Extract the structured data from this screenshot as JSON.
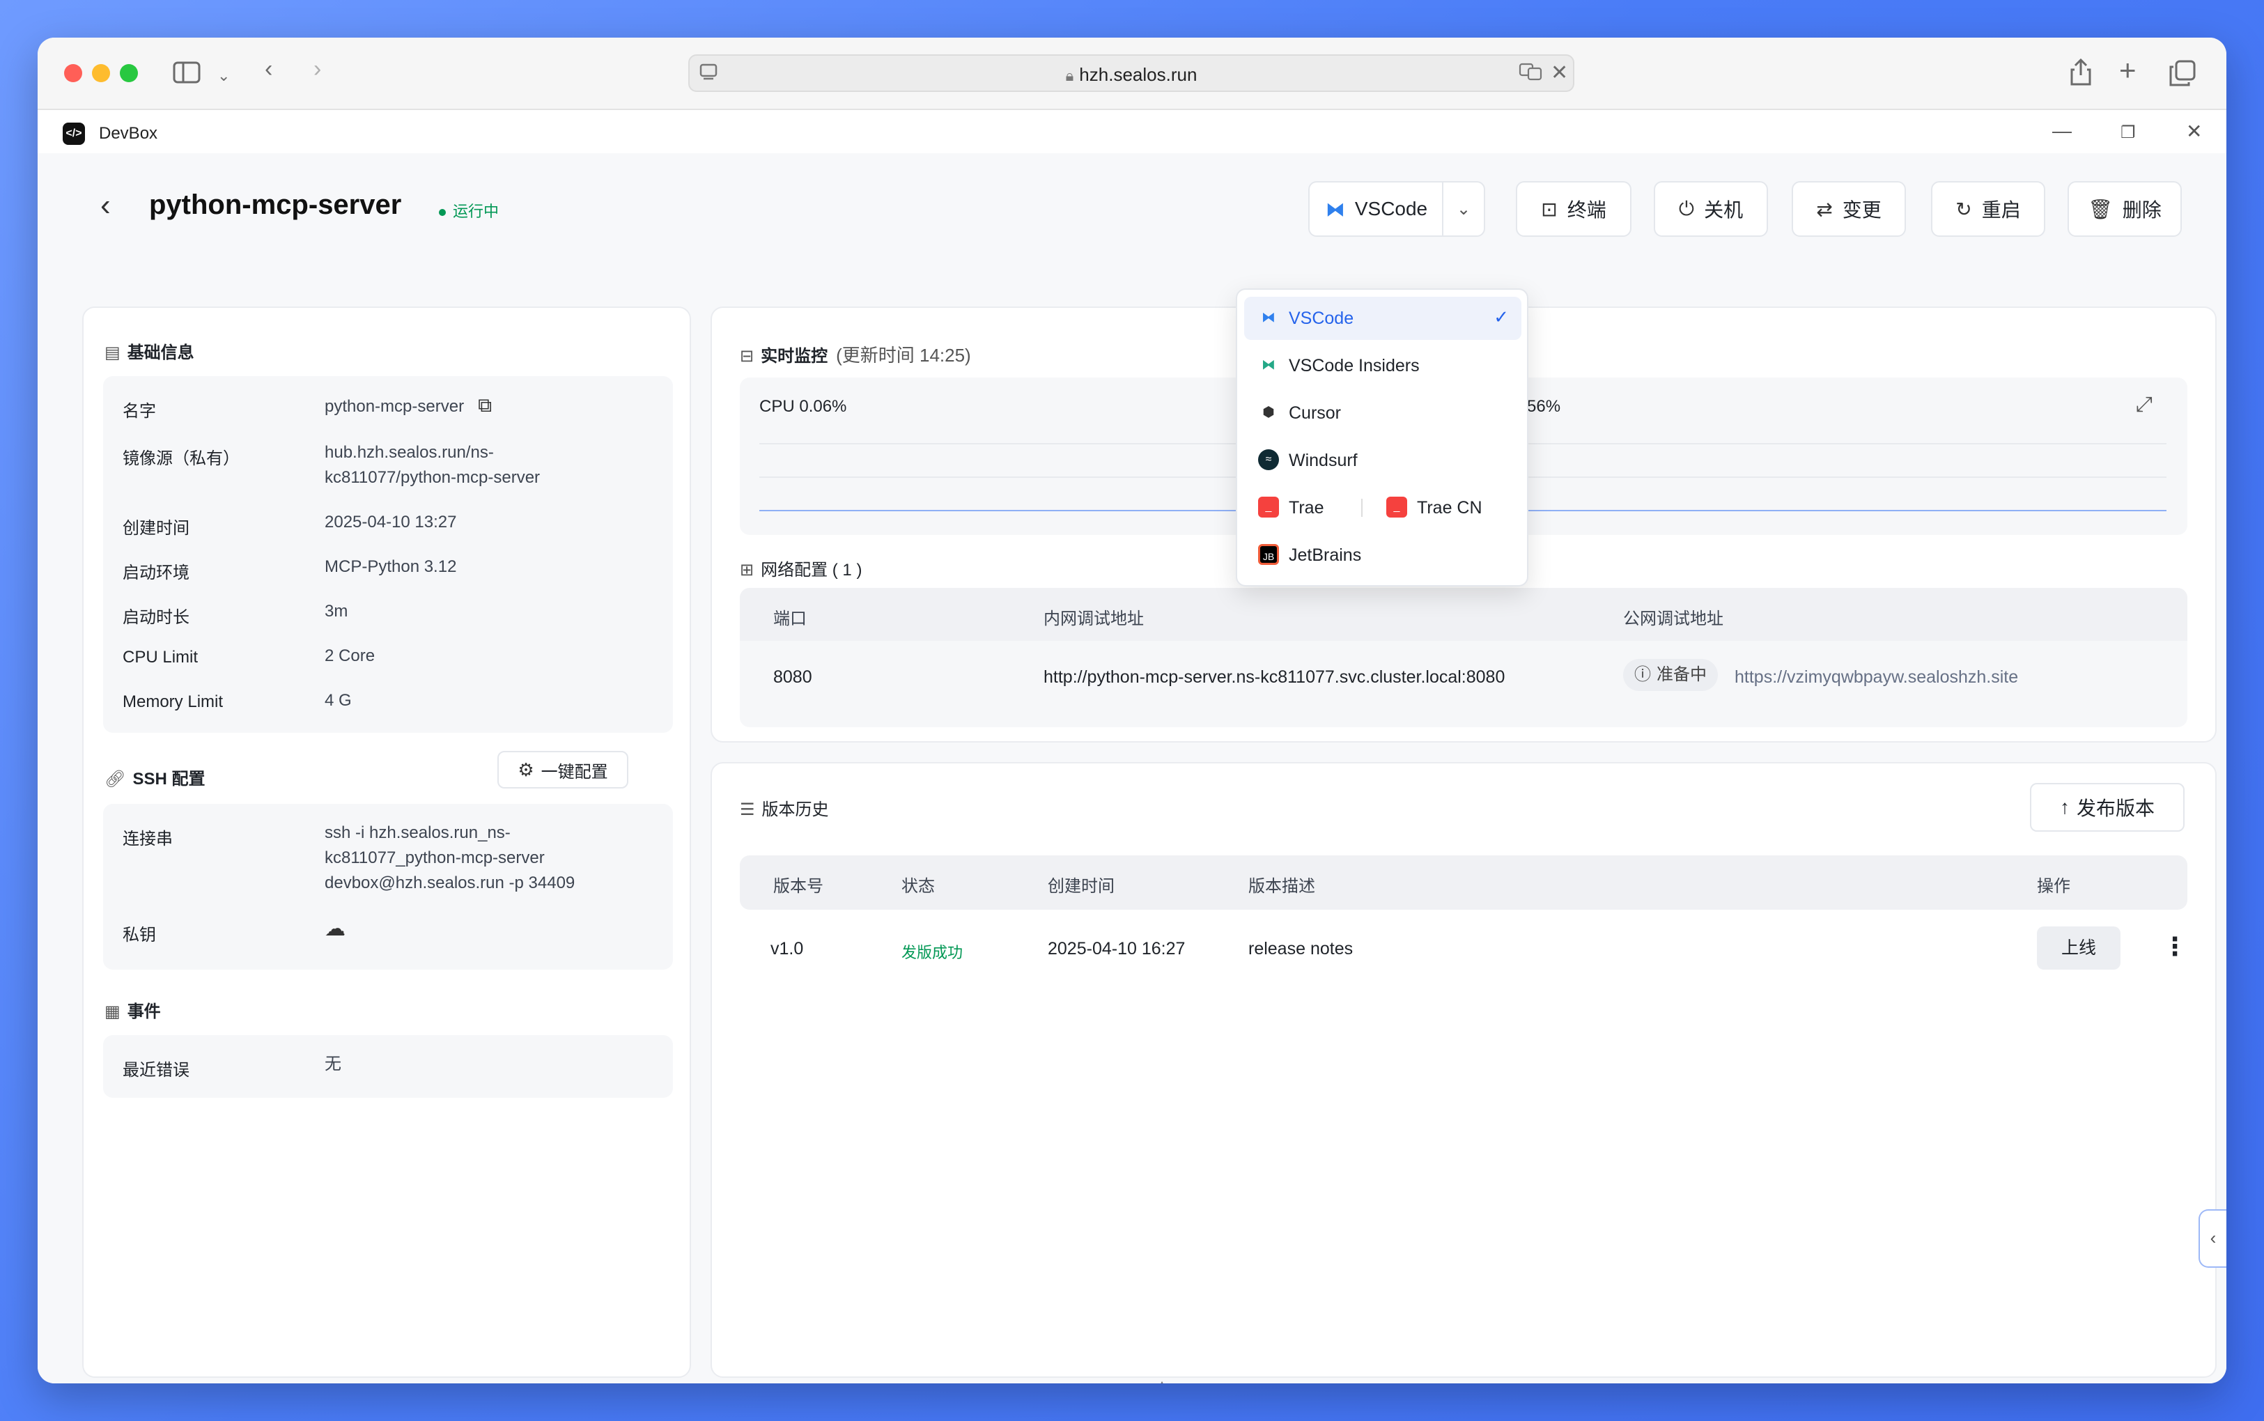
{
  "browser": {
    "url": "hzh.sealos.run"
  },
  "app": {
    "title": "DevBox"
  },
  "header": {
    "name": "python-mcp-server",
    "status": "运行中",
    "buttons": {
      "ide": "VSCode",
      "terminal": "终端",
      "shutdown": "关机",
      "change": "变更",
      "restart": "重启",
      "delete": "删除"
    }
  },
  "basic_info": {
    "title": "基础信息",
    "rows": [
      {
        "key": "名字",
        "value": "python-mcp-server"
      },
      {
        "key": "镜像源（私有）",
        "value": "hub.hzh.sealos.run/ns-",
        "value2": "kc811077/python-mcp-server"
      },
      {
        "key": "创建时间",
        "value": "2025-04-10 13:27"
      },
      {
        "key": "启动环境",
        "value": "MCP-Python 3.12"
      },
      {
        "key": "启动时长",
        "value": "3m"
      },
      {
        "key": "CPU Limit",
        "value": "2 Core"
      },
      {
        "key": "Memory Limit",
        "value": "4 G"
      }
    ]
  },
  "ssh": {
    "title": "SSH 配置",
    "config_button": "一键配置",
    "conn_key": "连接串",
    "conn_lines": [
      "ssh -i hzh.sealos.run_ns-",
      "kc811077_python-mcp-server",
      "devbox@hzh.sealos.run -p 34409"
    ],
    "private_key": "私钥"
  },
  "events": {
    "title": "事件",
    "key": "最近错误",
    "value": "无"
  },
  "monitor": {
    "title": "实时监控",
    "updated": "(更新时间  14:25)",
    "cpu_label": "CPU 0.06%",
    "mem_label": "56%"
  },
  "network": {
    "title": "网络配置 ( 1 )",
    "headers": [
      "端口",
      "内网调试地址",
      "公网调试地址"
    ],
    "port": "8080",
    "internal": "http://python-mcp-server.ns-kc811077.svc.cluster.local:8080",
    "badge": "准备中",
    "public": "https://vzimyqwbpayw.sealoshzh.site"
  },
  "versions": {
    "title": "版本历史",
    "publish_button": "发布版本",
    "headers": [
      "版本号",
      "状态",
      "创建时间",
      "版本描述",
      "操作"
    ],
    "row": {
      "version": "v1.0",
      "status": "发版成功",
      "created": "2025-04-10 16:27",
      "desc": "release notes",
      "action": "上线"
    }
  },
  "ide_menu": {
    "items": [
      "VSCode",
      "VSCode Insiders",
      "Cursor",
      "Windsurf",
      "Trae",
      "Trae CN",
      "JetBrains"
    ],
    "selected": "VSCode"
  },
  "colors": {
    "accent": "#2563eb",
    "success": "#039855"
  }
}
